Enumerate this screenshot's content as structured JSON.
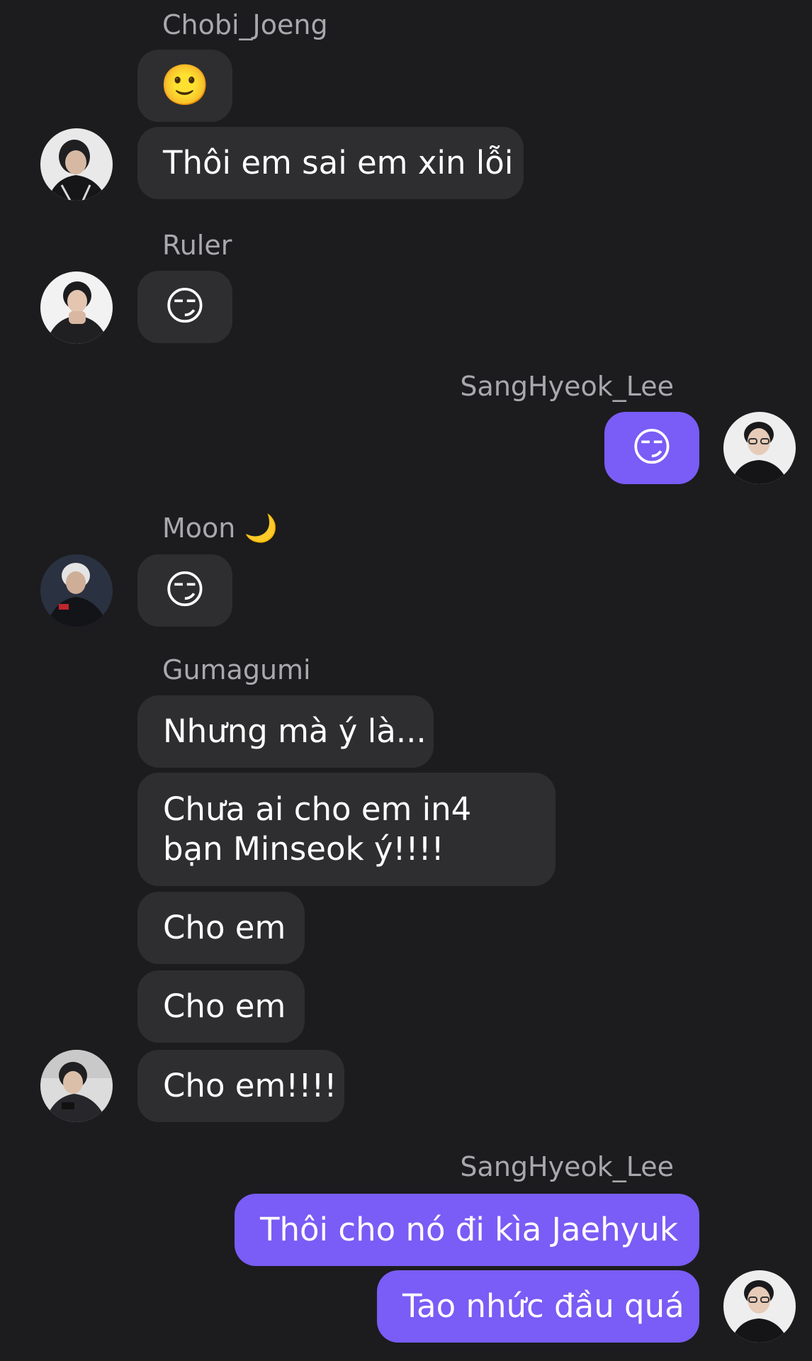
{
  "messages": [
    {
      "sender": "Chobi_Joeng",
      "bubbles": [
        "🙂",
        "Thôi em sai em xin lỗi"
      ]
    },
    {
      "sender": "Ruler",
      "bubbles": [
        "😏"
      ]
    },
    {
      "sender": "SangHyeok_Lee",
      "bubbles": [
        "😏"
      ]
    },
    {
      "sender": "Moon 🌙",
      "bubbles": [
        "😏"
      ]
    },
    {
      "sender": "Gumagumi",
      "bubbles": [
        "Nhưng mà ý là...",
        "Chưa ai cho em in4 bạn Minseok ý!!!!",
        "Cho em",
        "Cho em",
        "Cho em!!!!"
      ]
    },
    {
      "sender": "SangHyeok_Lee",
      "bubbles": [
        "Thôi cho nó đi kìa Jaehyuk",
        "Tao nhức đầu quá"
      ]
    }
  ],
  "avatars": {
    "chobi": "avatar-photo",
    "ruler": "avatar-photo",
    "faker": "avatar-photo",
    "moon": "avatar-photo",
    "gumagumi": "avatar-photo"
  },
  "colors": {
    "background": "#1c1c1e",
    "incoming_bubble": "#2e2e30",
    "outgoing_bubble": "#7a5cf6",
    "sender_name": "#a8a8ad"
  }
}
